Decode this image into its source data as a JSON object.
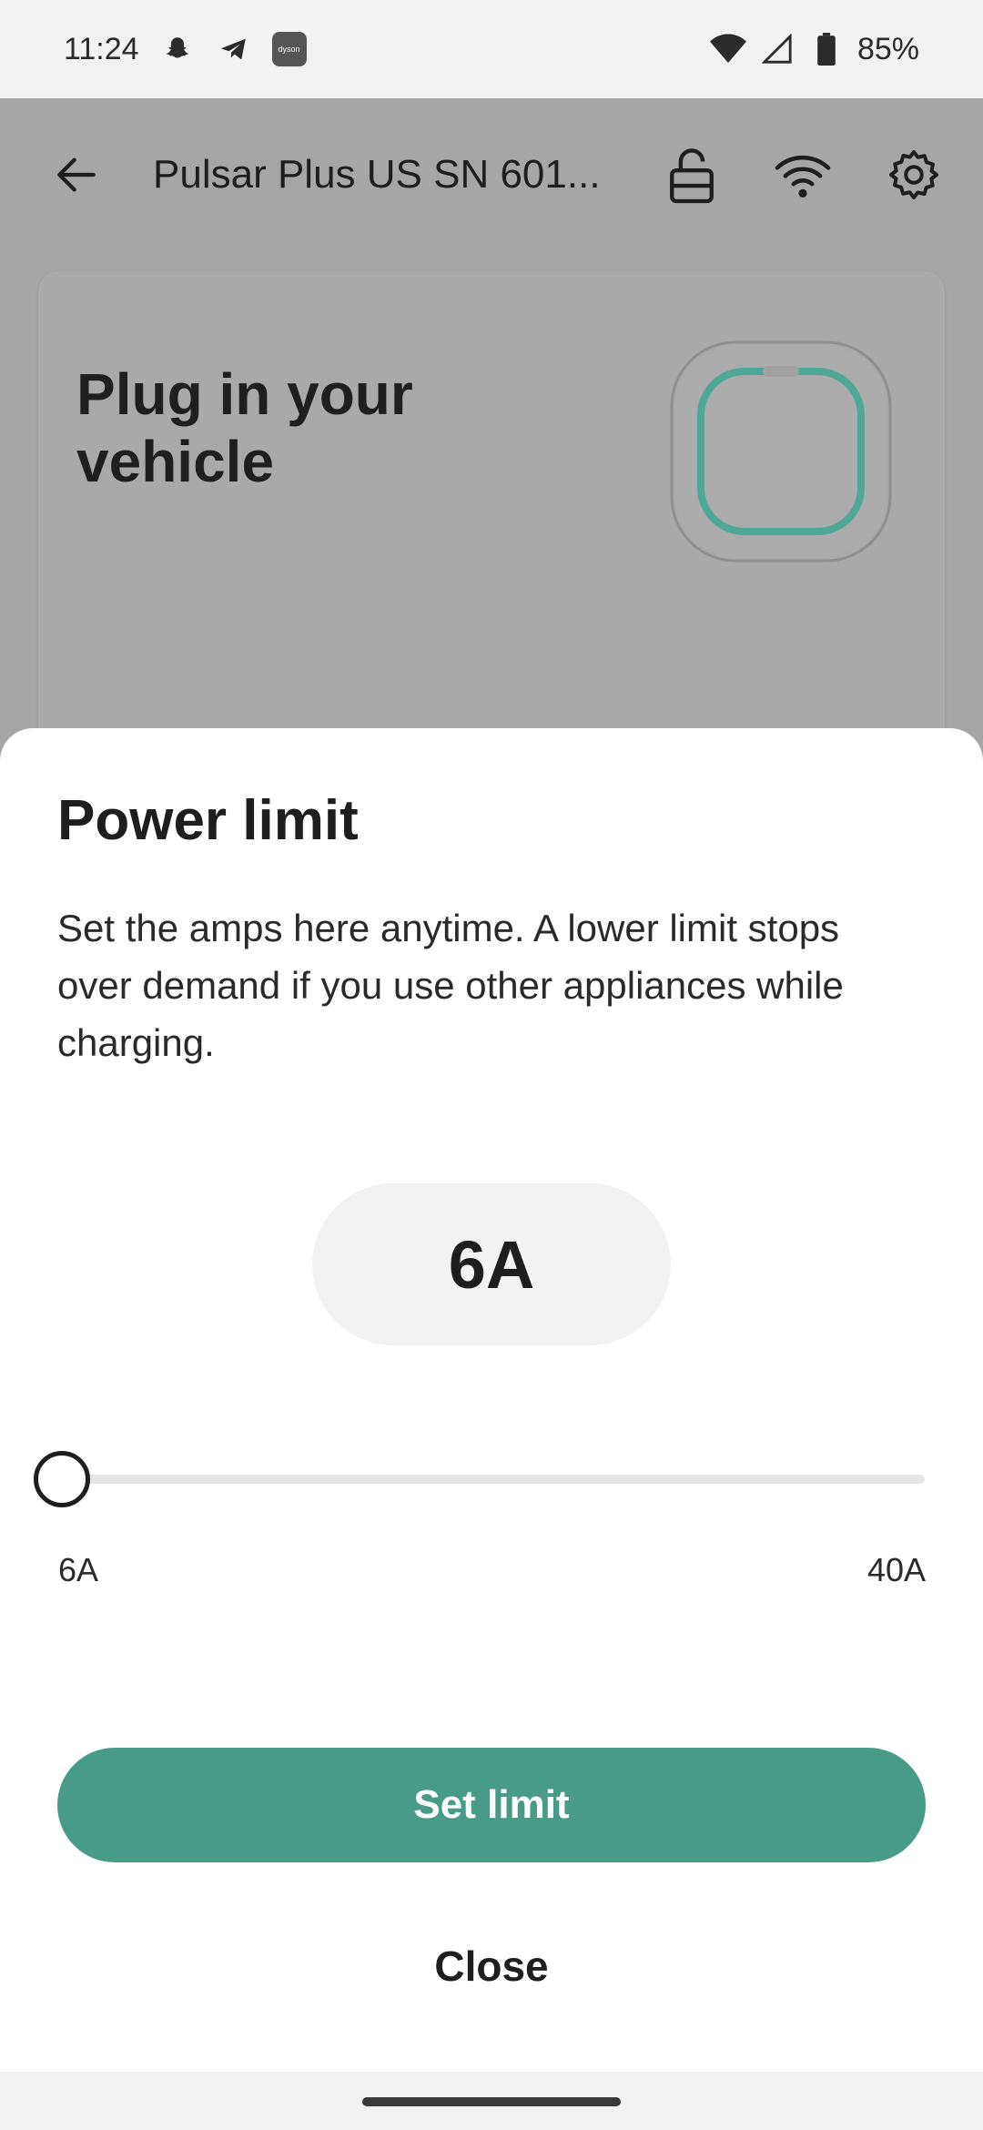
{
  "status_bar": {
    "time": "11:24",
    "notification_icons": [
      "snapchat-icon",
      "telegram-icon",
      "dyson-icon"
    ],
    "dyson_chip_label": "dyson",
    "battery_percent": "85%"
  },
  "app_bar": {
    "title": "Pulsar Plus US SN 601..."
  },
  "vehicle_card": {
    "title": "Plug in your vehicle",
    "accent_color": "#4ea896"
  },
  "sheet": {
    "title": "Power limit",
    "description": "Set the amps here anytime. A lower limit stops over demand if you use other appliances while charging.",
    "current_value": "6A",
    "slider": {
      "min_label": "6A",
      "max_label": "40A",
      "min": 6,
      "max": 40,
      "value": 6
    },
    "primary_button": "Set limit",
    "secondary_button": "Close",
    "primary_color": "#489b87"
  }
}
